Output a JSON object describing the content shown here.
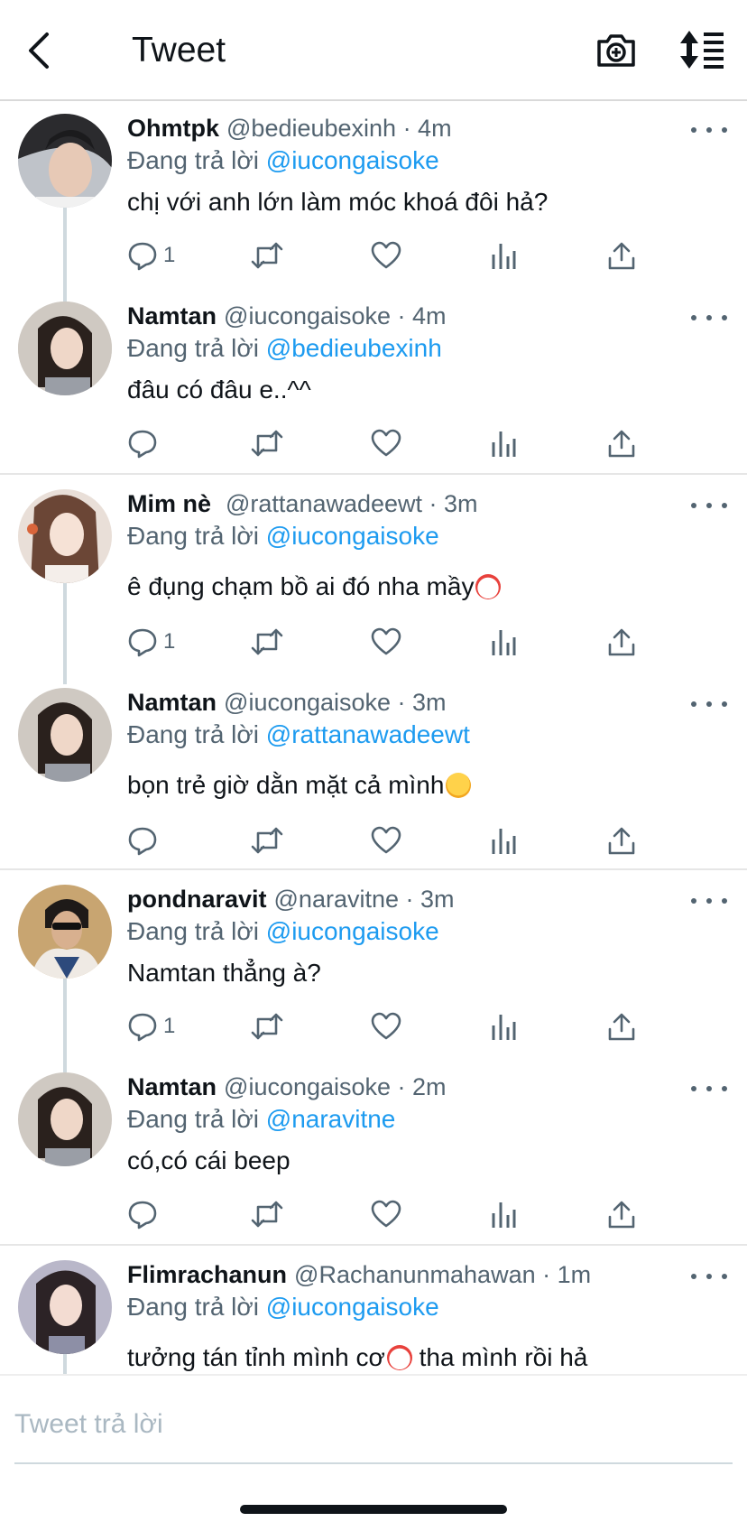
{
  "header": {
    "title": "Tweet",
    "back_icon": "chevron-left-icon",
    "camera_icon": "camera-plus-icon",
    "sort_icon": "sort-icon"
  },
  "colors": {
    "mention": "#1d9bf0",
    "secondary_text": "#536471",
    "primary_text": "#0f1419",
    "thread_line": "#cfd9de"
  },
  "tweets": [
    {
      "name": "Ohmtpk",
      "handle": "@bedieubexinh · 4m",
      "replying_prefix": "Đang trả lời",
      "replying_to": "@iucongaisoke",
      "text": "chị với anh lớn làm móc khoá đôi hả?",
      "reply_count": "1"
    },
    {
      "name": "Namtan",
      "handle": "@iucongaisoke · 4m",
      "replying_prefix": "Đang trả lời",
      "replying_to": "@bedieubexinh",
      "text": "đâu có đâu e..^^",
      "reply_count": ""
    },
    {
      "name": "Mim nè",
      "handle": "@rattanawadeewt · 3m",
      "replying_prefix": "Đang trả lời",
      "replying_to": "@iucongaisoke",
      "text": "ê đụng chạm bồ ai đó nha mầy",
      "emoji": "clown-face-emoji",
      "reply_count": "1"
    },
    {
      "name": "Namtan",
      "handle": "@iucongaisoke · 3m",
      "replying_prefix": "Đang trả lời",
      "replying_to": "@rattanawadeewt",
      "text": "bọn trẻ giờ dằn mặt cả mình",
      "emoji": "loudly-crying-face-emoji",
      "reply_count": ""
    },
    {
      "name": "pondnaravit",
      "handle": "@naravitne · 3m",
      "replying_prefix": "Đang trả lời",
      "replying_to": "@iucongaisoke",
      "text": "Namtan thẳng à?",
      "reply_count": "1"
    },
    {
      "name": "Namtan",
      "handle": "@iucongaisoke · 2m",
      "replying_prefix": "Đang trả lời",
      "replying_to": "@naravitne",
      "text": "có,có cái beep",
      "reply_count": ""
    },
    {
      "name": "Flimrachanun",
      "handle": "@Rachanunmahawan · 1m",
      "replying_prefix": "Đang trả lời",
      "replying_to": "@iucongaisoke",
      "text_before": "tưởng tán tỉnh mình cơ",
      "text_after": " tha mình rồi hả",
      "emoji": "clown-face-emoji"
    }
  ],
  "composer": {
    "placeholder": "Tweet trả lời"
  }
}
